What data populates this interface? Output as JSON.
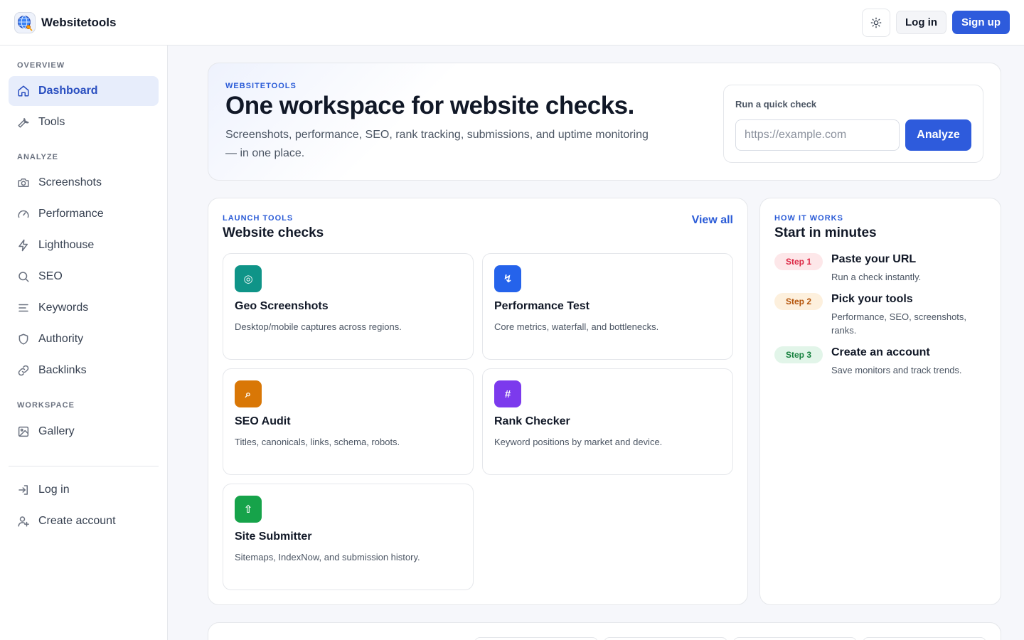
{
  "brand": {
    "name": "Websitetools",
    "logo_icon": "globe-key-icon"
  },
  "topbar": {
    "theme_icon": "sun-icon",
    "login_label": "Log in",
    "signup_label": "Sign up"
  },
  "sidebar": {
    "sections": [
      {
        "label": "OVERVIEW",
        "items": [
          {
            "label": "Dashboard",
            "icon": "home-icon",
            "active": true
          },
          {
            "label": "Tools",
            "icon": "wrench-icon",
            "active": false
          }
        ]
      },
      {
        "label": "ANALYZE",
        "items": [
          {
            "label": "Screenshots",
            "icon": "camera-icon"
          },
          {
            "label": "Performance",
            "icon": "gauge-icon"
          },
          {
            "label": "Lighthouse",
            "icon": "bolt-icon"
          },
          {
            "label": "SEO",
            "icon": "search-icon"
          },
          {
            "label": "Keywords",
            "icon": "lines-icon"
          },
          {
            "label": "Authority",
            "icon": "shield-icon"
          },
          {
            "label": "Backlinks",
            "icon": "link-icon"
          }
        ]
      },
      {
        "label": "WORKSPACE",
        "items": [
          {
            "label": "Gallery",
            "icon": "image-icon"
          }
        ]
      }
    ],
    "footer_items": [
      {
        "label": "Log in",
        "icon": "login-icon"
      },
      {
        "label": "Create account",
        "icon": "user-plus-icon"
      }
    ]
  },
  "hero": {
    "eyebrow": "WEBSITETOOLS",
    "title": "One workspace for website checks.",
    "description_line1": "Screenshots, performance, SEO, rank tracking, submissions, and uptime monitoring",
    "description_line2": "— in one place.",
    "quick_check": {
      "label": "Run a quick check",
      "placeholder": "https://example.com",
      "value": "",
      "button_label": "Analyze"
    }
  },
  "tools": {
    "eyebrow": "LAUNCH TOOLS",
    "title": "Website checks",
    "view_all_label": "View all",
    "items": [
      {
        "name": "Geo Screenshots",
        "desc": "Desktop/mobile captures across regions.",
        "glyph": "◎",
        "color": "#0f9488"
      },
      {
        "name": "Performance Test",
        "desc": "Core metrics, waterfall, and bottlenecks.",
        "glyph": "↯",
        "color": "#2563eb"
      },
      {
        "name": "SEO Audit",
        "desc": "Titles, canonicals, links, schema, robots.",
        "glyph": "⌕",
        "color": "#d97706"
      },
      {
        "name": "Rank Checker",
        "desc": "Keyword positions by market and device.",
        "glyph": "#",
        "color": "#7c3aed"
      },
      {
        "name": "Site Submitter",
        "desc": "Sitemaps, IndexNow, and submission history.",
        "glyph": "⇧",
        "color": "#16a34a"
      }
    ]
  },
  "how": {
    "eyebrow": "HOW IT WORKS",
    "title": "Start in minutes",
    "steps": [
      {
        "badge": "Step 1",
        "title": "Paste your URL",
        "desc": "Run a check instantly.",
        "badge_bg": "#fde7e9",
        "badge_color": "#dc2643"
      },
      {
        "badge": "Step 2",
        "title": "Pick your tools",
        "desc": "Performance, SEO, screenshots, ranks.",
        "badge_bg": "#fdf0dd",
        "badge_color": "#b45309"
      },
      {
        "badge": "Step 3",
        "title": "Create an account",
        "desc": "Save monitors and track trends.",
        "badge_bg": "#e2f5e9",
        "badge_color": "#15803d"
      }
    ]
  },
  "colors": {
    "accent": "#2e5bdc",
    "active_bg": "#e7edfb"
  }
}
